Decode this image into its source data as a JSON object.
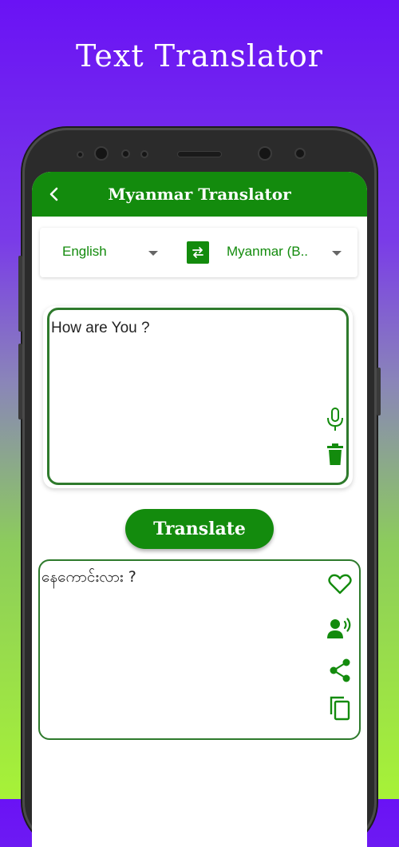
{
  "promo": {
    "title": "Text Translator"
  },
  "appbar": {
    "title": "Myanmar Translator"
  },
  "languages": {
    "source": "English",
    "target": "Myanmar (B.."
  },
  "input": {
    "text": "How are You ?"
  },
  "translate_button": {
    "label": "Translate"
  },
  "output": {
    "text": "နေကောင်းလား ?"
  },
  "colors": {
    "primary": "#138b0d",
    "border": "#2e7a2c",
    "gradient_top": "#6a12f5",
    "gradient_bottom": "#a7f237"
  },
  "icons": {
    "back": "back-arrow-icon",
    "swap": "swap-icon",
    "mic": "mic-icon",
    "delete": "trash-icon",
    "favorite": "heart-icon",
    "speak": "speaker-voice-icon",
    "share": "share-icon",
    "copy": "copy-icon"
  }
}
